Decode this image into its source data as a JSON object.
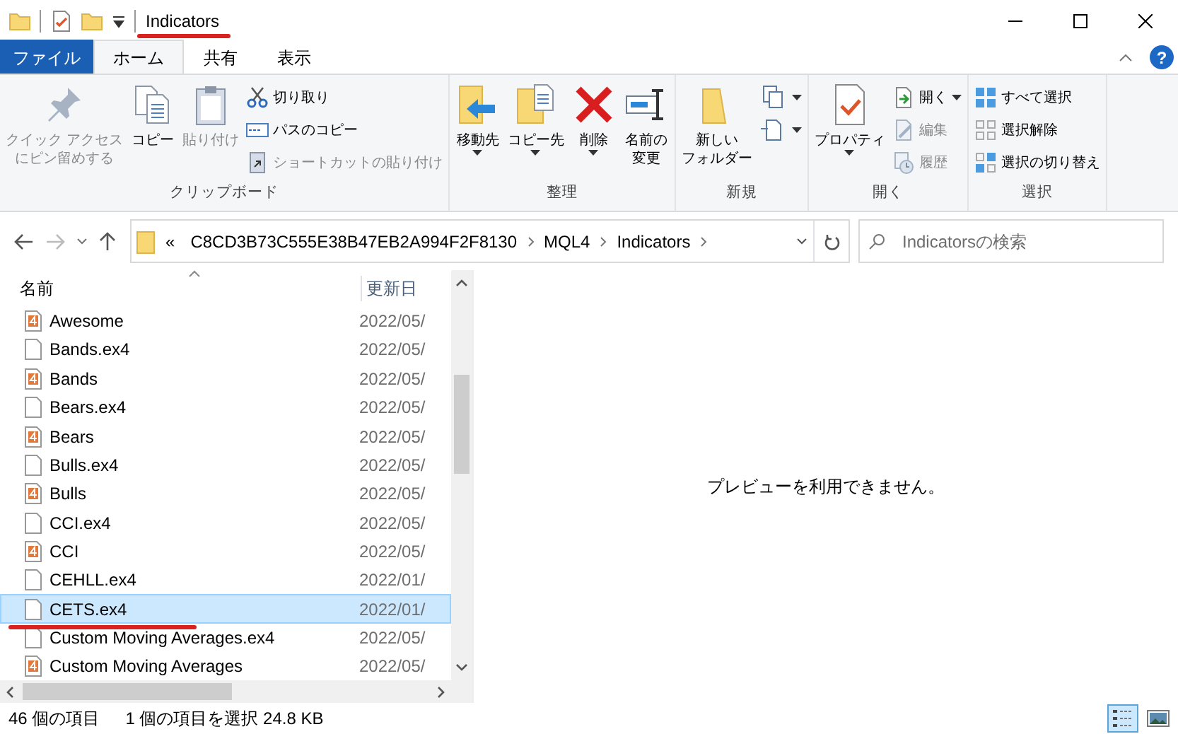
{
  "title_bar": {
    "title": "Indicators",
    "annotated": true
  },
  "ribbon_tabs": [
    {
      "label": "ファイル",
      "kind": "file",
      "selected": false
    },
    {
      "label": "ホーム",
      "kind": "tab",
      "selected": true
    },
    {
      "label": "共有",
      "kind": "tab",
      "selected": false
    },
    {
      "label": "表示",
      "kind": "tab",
      "selected": false
    }
  ],
  "help": "?",
  "ribbon_groups": [
    {
      "label": "クリップボード",
      "items": [
        {
          "kind": "large",
          "lines": [
            "クイック アクセス",
            "にピン留めする"
          ],
          "disabled": true,
          "dropdown": false
        },
        {
          "kind": "large",
          "lines": [
            "コピー"
          ],
          "disabled": false,
          "dropdown": false
        },
        {
          "kind": "large",
          "lines": [
            "貼り付け"
          ],
          "disabled": true,
          "dropdown": false
        },
        {
          "kind": "small",
          "lines": [
            "切り取り"
          ],
          "disabled": false,
          "dropdown": false
        },
        {
          "kind": "small",
          "lines": [
            "パスのコピー"
          ],
          "disabled": false,
          "dropdown": false
        },
        {
          "kind": "small",
          "lines": [
            "ショートカットの貼り付け"
          ],
          "disabled": true,
          "dropdown": false
        }
      ]
    },
    {
      "label": "整理",
      "items": [
        {
          "kind": "large",
          "lines": [
            "移動先"
          ],
          "disabled": false,
          "dropdown": true
        },
        {
          "kind": "large",
          "lines": [
            "コピー先"
          ],
          "disabled": false,
          "dropdown": true
        },
        {
          "kind": "large",
          "lines": [
            "削除"
          ],
          "disabled": false,
          "dropdown": true
        },
        {
          "kind": "large",
          "lines": [
            "名前の",
            "変更"
          ],
          "disabled": false,
          "dropdown": false
        }
      ]
    },
    {
      "label": "新規",
      "items": [
        {
          "kind": "large",
          "lines": [
            "新しい",
            "フォルダー"
          ],
          "disabled": false,
          "dropdown": false
        },
        {
          "kind": "small",
          "disabled": false,
          "dropdown": true
        },
        {
          "kind": "small",
          "disabled": false,
          "dropdown": true
        }
      ]
    },
    {
      "label": "開く",
      "items": [
        {
          "kind": "large",
          "lines": [
            "プロパティ"
          ],
          "disabled": false,
          "dropdown": true
        },
        {
          "kind": "small",
          "lines": [
            "開く"
          ],
          "disabled": false,
          "dropdown": true
        },
        {
          "kind": "small",
          "lines": [
            "編集"
          ],
          "disabled": true,
          "dropdown": false
        },
        {
          "kind": "small",
          "lines": [
            "履歴"
          ],
          "disabled": true,
          "dropdown": false
        }
      ]
    },
    {
      "label": "選択",
      "items": [
        {
          "kind": "small",
          "lines": [
            "すべて選択"
          ],
          "disabled": false,
          "dropdown": false
        },
        {
          "kind": "small",
          "lines": [
            "選択解除"
          ],
          "disabled": false,
          "dropdown": false
        },
        {
          "kind": "small",
          "lines": [
            "選択の切り替え"
          ],
          "disabled": false,
          "dropdown": false
        }
      ]
    }
  ],
  "address_bar": {
    "overflow": "«",
    "crumbs": [
      "C8CD3B73C555E38B47EB2A994F2F8130",
      "MQL4",
      "Indicators"
    ]
  },
  "search": {
    "placeholder": "Indicatorsの検索"
  },
  "file_list": {
    "columns": [
      "名前",
      "更新日"
    ],
    "rows": [
      {
        "name": "Awesome",
        "date": "2022/05/",
        "kind": "mq4",
        "selected": false,
        "annotated": false
      },
      {
        "name": "Bands.ex4",
        "date": "2022/05/",
        "kind": "ex4",
        "selected": false,
        "annotated": false
      },
      {
        "name": "Bands",
        "date": "2022/05/",
        "kind": "mq4",
        "selected": false,
        "annotated": false
      },
      {
        "name": "Bears.ex4",
        "date": "2022/05/",
        "kind": "ex4",
        "selected": false,
        "annotated": false
      },
      {
        "name": "Bears",
        "date": "2022/05/",
        "kind": "mq4",
        "selected": false,
        "annotated": false
      },
      {
        "name": "Bulls.ex4",
        "date": "2022/05/",
        "kind": "ex4",
        "selected": false,
        "annotated": false
      },
      {
        "name": "Bulls",
        "date": "2022/05/",
        "kind": "mq4",
        "selected": false,
        "annotated": false
      },
      {
        "name": "CCI.ex4",
        "date": "2022/05/",
        "kind": "ex4",
        "selected": false,
        "annotated": false
      },
      {
        "name": "CCI",
        "date": "2022/05/",
        "kind": "mq4",
        "selected": false,
        "annotated": false
      },
      {
        "name": "CEHLL.ex4",
        "date": "2022/01/",
        "kind": "ex4",
        "selected": false,
        "annotated": false
      },
      {
        "name": "CETS.ex4",
        "date": "2022/01/",
        "kind": "ex4",
        "selected": true,
        "annotated": true
      },
      {
        "name": "Custom Moving Averages.ex4",
        "date": "2022/05/",
        "kind": "ex4",
        "selected": false,
        "annotated": false
      },
      {
        "name": "Custom Moving Averages",
        "date": "2022/05/",
        "kind": "mq4",
        "selected": false,
        "annotated": false
      }
    ]
  },
  "preview": {
    "message": "プレビューを利用できません。"
  },
  "status_bar": {
    "count": "46 個の項目",
    "selection": "1 個の項目を選択  24.8 KB",
    "views": [
      {
        "kind": "details",
        "selected": true
      },
      {
        "kind": "large_icons",
        "selected": false
      }
    ]
  }
}
